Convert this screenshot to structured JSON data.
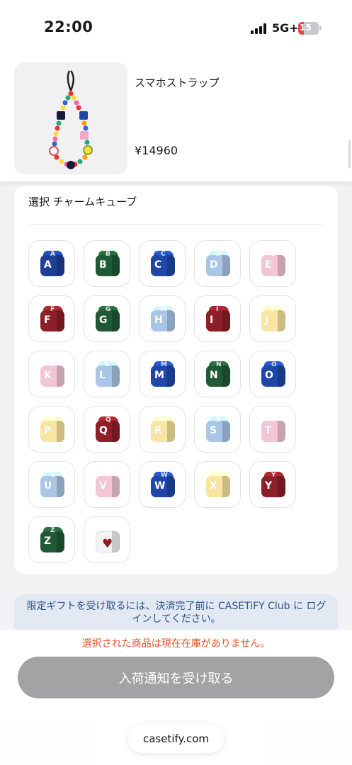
{
  "status_bar": {
    "time": "22:00",
    "network": "5G+",
    "battery": "15"
  },
  "product": {
    "name": "スマホストラップ",
    "price": "¥14960",
    "thumbnail_icon": "phone-strap-image"
  },
  "charm_section": {
    "title": "選択 チャームキューブ",
    "cubes": [
      {
        "label": "A",
        "color": "#1e3f98"
      },
      {
        "label": "B",
        "color": "#1f5a34"
      },
      {
        "label": "C",
        "color": "#1f46a8"
      },
      {
        "label": "D",
        "color": "#a9c6e6"
      },
      {
        "label": "E",
        "color": "#f3c6d6"
      },
      {
        "label": "F",
        "color": "#8c1f27"
      },
      {
        "label": "G",
        "color": "#1f5a34"
      },
      {
        "label": "H",
        "color": "#a9c6e6"
      },
      {
        "label": "I",
        "color": "#8c1f27"
      },
      {
        "label": "J",
        "color": "#f7e5a1"
      },
      {
        "label": "K",
        "color": "#f3c6d6"
      },
      {
        "label": "L",
        "color": "#a9c6e6"
      },
      {
        "label": "M",
        "color": "#1f46a8"
      },
      {
        "label": "N",
        "color": "#1f5a34"
      },
      {
        "label": "O",
        "color": "#1f46a8"
      },
      {
        "label": "P",
        "color": "#f7e5a1"
      },
      {
        "label": "Q",
        "color": "#8c1f27"
      },
      {
        "label": "R",
        "color": "#f7e5a1"
      },
      {
        "label": "S",
        "color": "#a9c6e6"
      },
      {
        "label": "T",
        "color": "#f3c6d6"
      },
      {
        "label": "U",
        "color": "#a9c6e6"
      },
      {
        "label": "V",
        "color": "#f3c6d6"
      },
      {
        "label": "W",
        "color": "#1f46a8"
      },
      {
        "label": "X",
        "color": "#f7e5a1"
      },
      {
        "label": "Y",
        "color": "#8c1f27"
      },
      {
        "label": "Z",
        "color": "#1f5a34"
      },
      {
        "label": "♥",
        "color": "#f4f4f4",
        "icon": "heart-icon"
      }
    ]
  },
  "notice": {
    "text": "限定ギフトを受け取るには、決済完了前に CASETiFY Club に ログインしてください。"
  },
  "stock": {
    "message": "選択された商品は現在在庫がありません。"
  },
  "actions": {
    "notify_label": "入荷通知を受け取る"
  },
  "browser": {
    "url": "casetify.com"
  }
}
